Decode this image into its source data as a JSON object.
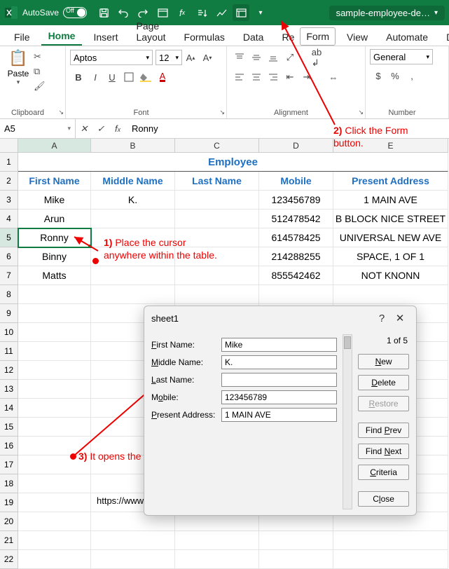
{
  "qat": {
    "autoSave": "AutoSave",
    "autoSaveState": "Off",
    "filename": "sample-employee-de…"
  },
  "tabs": [
    "File",
    "Home",
    "Insert",
    "Page Layout",
    "Formulas",
    "Data",
    "Review",
    "Form",
    "View",
    "Automate",
    "Developer"
  ],
  "ribbon": {
    "paste": "Paste",
    "groups": {
      "clipboard": "Clipboard",
      "font": "Font",
      "alignment": "Alignment",
      "number": "Number"
    },
    "fontName": "Aptos",
    "fontSize": "12",
    "numberFormat": "General"
  },
  "namebox": "A5",
  "formula": "Ronny",
  "columns": [
    "A",
    "B",
    "C",
    "D",
    "E"
  ],
  "table": {
    "title": "Employee",
    "headers": [
      "First Name",
      "Middle Name",
      "Last Name",
      "Mobile",
      "Present Address"
    ],
    "rows": [
      [
        "Mike",
        "K.",
        "",
        "123456789",
        "1 MAIN AVE"
      ],
      [
        "Arun",
        "",
        "",
        "512478542",
        "B BLOCK NICE STREET"
      ],
      [
        "Ronny",
        "",
        "",
        "614578425",
        "UNIVERSAL NEW AVE"
      ],
      [
        "Binny",
        "",
        "",
        "214288255",
        "SPACE, 1 OF 1"
      ],
      [
        "Matts",
        "",
        "",
        "855542462",
        "NOT KNONN"
      ]
    ]
  },
  "annot": {
    "a1_num": "1)",
    "a1": "Place the cursor anywhere within the table.",
    "a2_num": "2)",
    "a2": "Click the Form button.",
    "a3_num": "3)",
    "a3": "It opens the form."
  },
  "dialog": {
    "title": "sheet1",
    "counter": "1 of 5",
    "labels": {
      "first": "First Name:",
      "middle": "Middle Name:",
      "last": "Last Name:",
      "mobile": "Mobile:",
      "addr": "Present Address:"
    },
    "values": {
      "first": "Mike",
      "middle": "K.",
      "last": "",
      "mobile": "123456789",
      "addr": "1 MAIN AVE"
    },
    "buttons": {
      "new": "New",
      "delete": "Delete",
      "restore": "Restore",
      "prev": "Find Prev",
      "next": "Find Next",
      "criteria": "Criteria",
      "close": "Close"
    }
  },
  "url": "https://www.encodedna.com"
}
